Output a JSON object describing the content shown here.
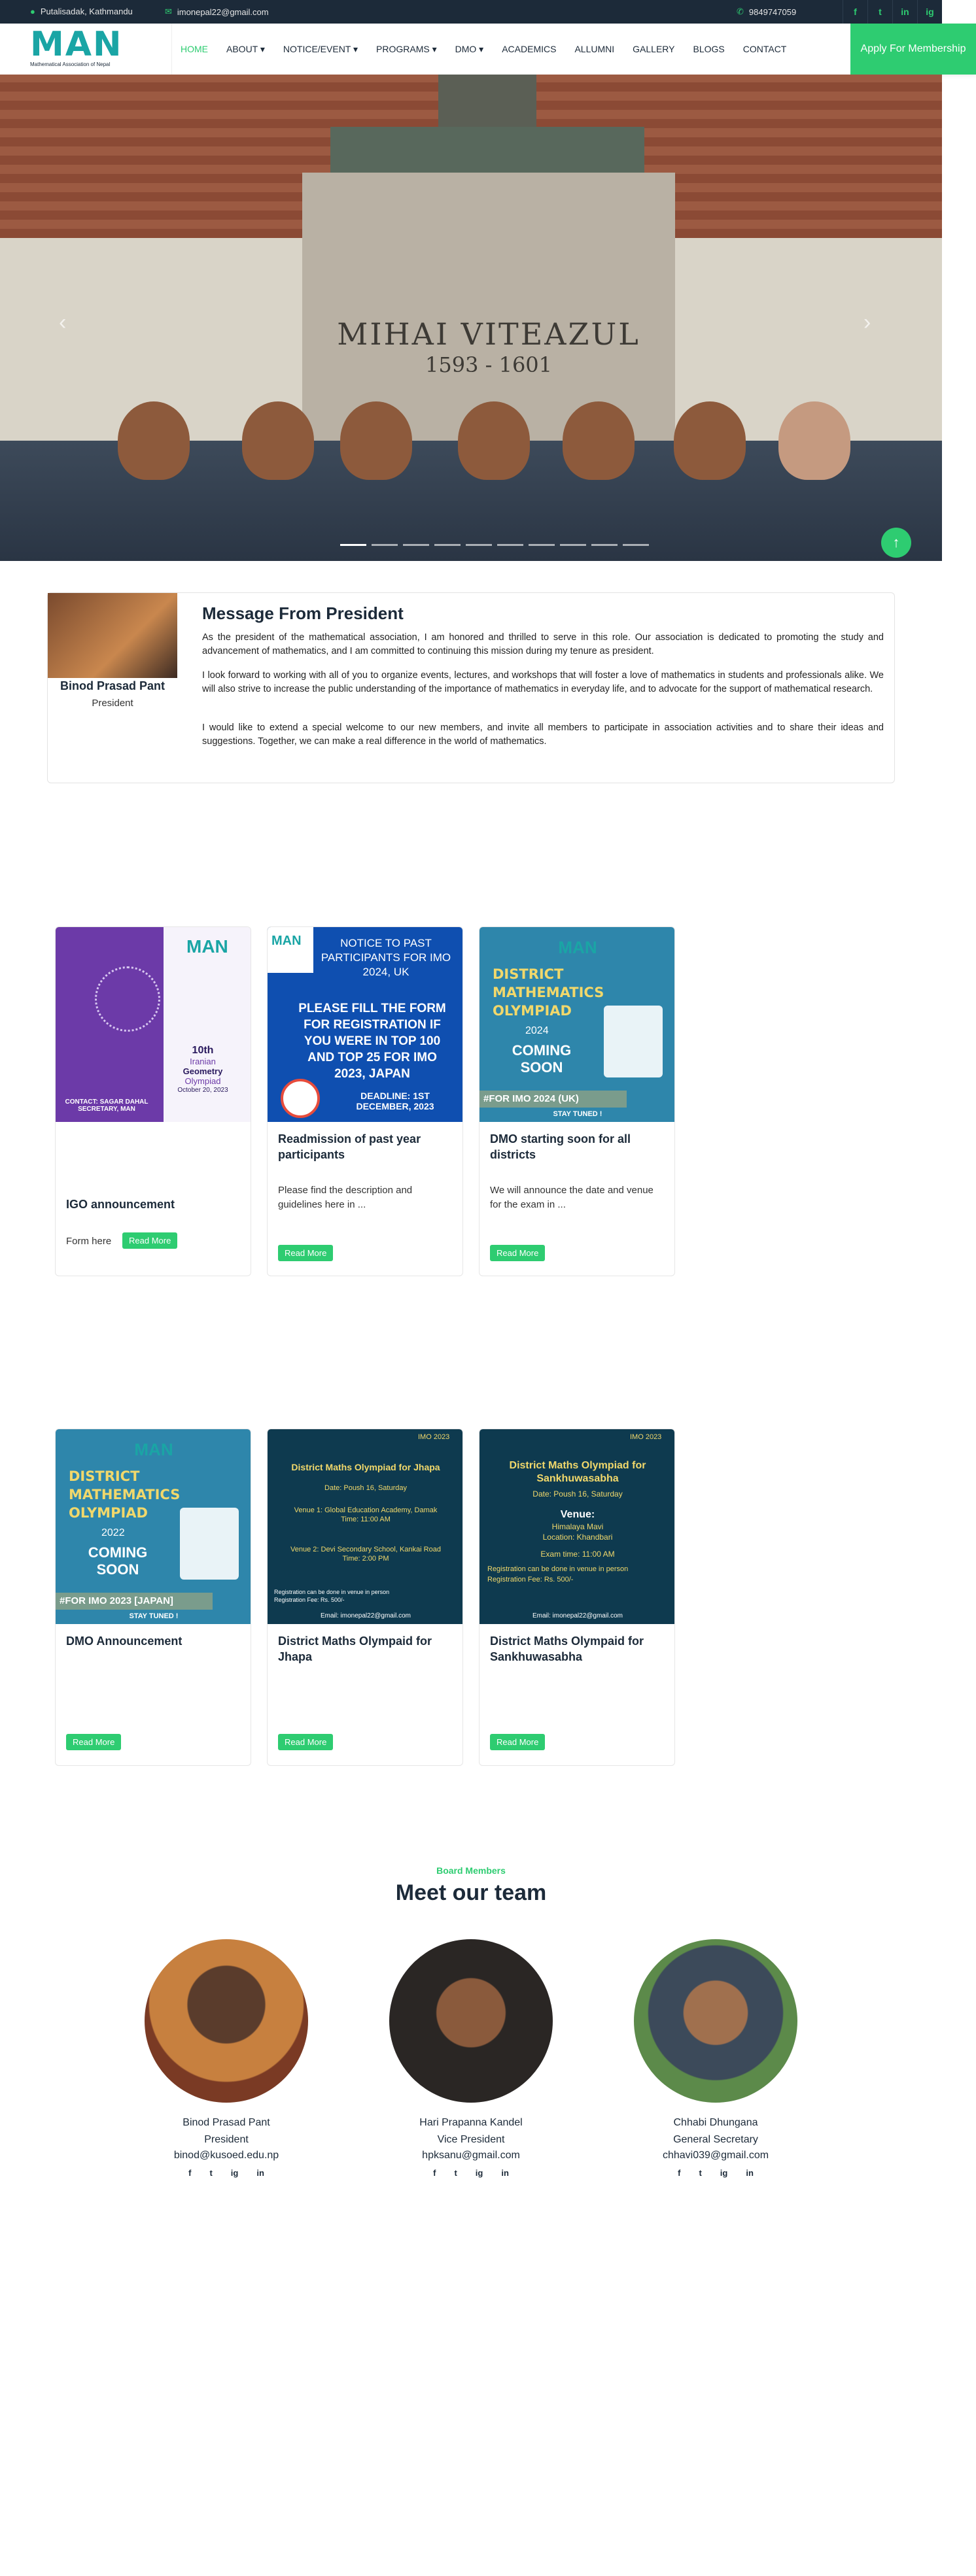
{
  "topbar": {
    "location": "Putalisadak, Kathmandu",
    "email": "imonepal22@gmail.com",
    "phone": "9849747059",
    "social": [
      "f",
      "t",
      "in",
      "ig"
    ]
  },
  "brand": {
    "logo_text": "MAN",
    "logo_sub": "Mathematical Association of Nepal"
  },
  "nav": {
    "items": [
      "HOME",
      "ABOUT ▾",
      "NOTICE/EVENT ▾",
      "PROGRAMS ▾",
      "DMO ▾",
      "ACADEMICS",
      "ALLUMNI",
      "GALLERY",
      "BLOGS",
      "CONTACT"
    ],
    "apply": "Apply For Membership"
  },
  "hero": {
    "inscription": "MIHAI VITEAZUL",
    "years": "1593 - 1601",
    "slides": 10,
    "active_slide": 1
  },
  "president": {
    "name": "Binod Prasad Pant",
    "role": "President",
    "title": "Message From President",
    "paragraphs": [
      "As the president of the mathematical association, I am honored and thrilled to serve in this role. Our association is dedicated to promoting the study and advancement of mathematics, and I am committed to continuing this mission during my tenure as president.",
      "I look forward to working with all of you to organize events, lectures, and workshops that will foster a love of mathematics in students and professionals alike. We will also strive to increase the public understanding of the importance of mathematics in everyday life, and to advocate for the support of mathematical research.",
      "I would like to extend a special welcome to our new members, and invite all members to participate in association activities and to share their ideas and suggestions. Together, we can make a real difference in the world of mathematics."
    ]
  },
  "notices": [
    {
      "title": "IGO announcement",
      "desc": "Form here",
      "button": "Read More",
      "poster": {
        "line1": "10th",
        "line2": "Iranian",
        "line3": "Geometry",
        "line4": "Olympiad",
        "date": "October 20, 2023",
        "contact": "CONTACT: SAGAR DAHAL SECRETARY, MAN",
        "brand": "MAN"
      }
    },
    {
      "title": "Readmission of past year participants",
      "desc": "Please find the description and guidelines here in ...",
      "button": "Read More",
      "poster": {
        "head": "NOTICE TO PAST PARTICIPANTS FOR IMO 2024, UK",
        "body": "PLEASE FILL THE FORM FOR REGISTRATION IF YOU WERE IN TOP 100 AND TOP 25 FOR IMO 2023, JAPAN",
        "deadline": "DEADLINE: 1ST DECEMBER, 2023",
        "brand": "MAN"
      }
    },
    {
      "title": "DMO starting soon for all districts",
      "desc": "We will announce the date and venue for the exam in ...",
      "button": "Read More",
      "poster": {
        "head": "DISTRICT MATHEMATICS OLYMPIAD",
        "year": "2024",
        "soon": "COMING SOON",
        "tag": "#FOR IMO 2024 (UK)",
        "stay": "STAY TUNED !",
        "brand": "MAN"
      }
    }
  ],
  "dmo": [
    {
      "title": "DMO Announcement",
      "button": "Read More",
      "poster": {
        "head": "DISTRICT MATHEMATICS OLYMPIAD",
        "year": "2022",
        "soon": "COMING SOON",
        "tag": "#FOR IMO 2023 [JAPAN]",
        "stay": "STAY TUNED !",
        "brand": "MAN"
      }
    },
    {
      "title": "District Maths Olympaid for Jhapa",
      "button": "Read More",
      "poster": {
        "head": "District Maths Olympiad for Jhapa",
        "date": "Date: Poush 16, Saturday",
        "v1": "Venue 1: Global Education Academy, Damak",
        "t1": "Time: 11:00 AM",
        "v2": "Venue 2: Devi Secondary School, Kankai Road",
        "t2": "Time: 2:00 PM",
        "reg": "Registration can be done in venue in person",
        "fee": "Registration Fee: Rs. 500/-",
        "email": "Email: imonepal22@gmail.com",
        "badge": "IMO 2023"
      }
    },
    {
      "title": "District Maths Olympaid for Sankhuwasabha",
      "button": "Read More",
      "poster": {
        "head": "District Maths Olympiad for Sankhuwasabha",
        "date": "Date: Poush 16, Saturday",
        "venue_label": "Venue:",
        "venue": "Himalaya Mavi",
        "location": "Location: Khandbari",
        "time": "Exam time: 11:00 AM",
        "reg": "Registration can be done in venue in person",
        "fee": "Registration Fee: Rs. 500/-",
        "email": "Email: imonepal22@gmail.com",
        "badge": "IMO 2023"
      }
    }
  ],
  "team": {
    "label": "Board Members",
    "title": "Meet our team",
    "members": [
      {
        "name": "Binod Prasad Pant",
        "role": "President",
        "email": "binod@kusoed.edu.np"
      },
      {
        "name": "Hari Prapanna Kandel",
        "role": "Vice President",
        "email": "hpksanu@gmail.com"
      },
      {
        "name": "Chhabi Dhungana",
        "role": "General Secretary",
        "email": "chhavi039@gmail.com"
      }
    ],
    "social": [
      "f",
      "t",
      "ig",
      "in"
    ]
  },
  "colors": {
    "accent": "#2ecc71",
    "dark": "#1c2a39",
    "teal": "#1aa5a5"
  }
}
